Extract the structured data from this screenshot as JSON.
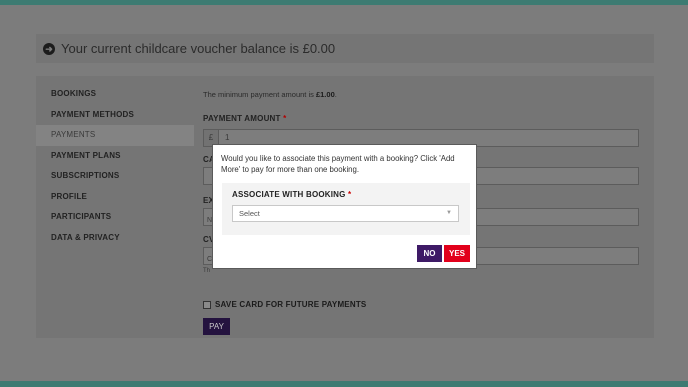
{
  "voucher": {
    "icon": "arrow-right-circle-icon",
    "text": "Your current childcare voucher balance is £0.00"
  },
  "sidebar": {
    "items": [
      {
        "label": "BOOKINGS"
      },
      {
        "label": "PAYMENT METHODS"
      },
      {
        "label": "PAYMENTS",
        "active": true
      },
      {
        "label": "PAYMENT PLANS"
      },
      {
        "label": "SUBSCRIPTIONS"
      },
      {
        "label": "PROFILE"
      },
      {
        "label": "PARTICIPANTS"
      },
      {
        "label": "DATA & PRIVACY"
      }
    ]
  },
  "form": {
    "min_note_prefix": "The minimum payment amount is ",
    "min_note_amount": "£1.00",
    "min_note_suffix": ".",
    "amount_label": "PAYMENT AMOUNT",
    "required_mark": "*",
    "currency": "£",
    "amount_value": "1",
    "card_label_partial": "CA",
    "expiry_label_partial": "EX",
    "expiry_value_partial": "N",
    "cvv_label_partial": "CV",
    "cvv_value_partial": "C",
    "cvv_hint_partial": "Th",
    "save_card_label": "SAVE CARD FOR FUTURE PAYMENTS",
    "pay_button": "PAY"
  },
  "modal": {
    "message": "Would you like to associate this payment with a booking? Click 'Add More' to pay for more than one booking.",
    "associate_label": "ASSOCIATE WITH BOOKING",
    "required_mark": "*",
    "select_placeholder": "Select",
    "no_button": "NO",
    "yes_button": "YES"
  },
  "colors": {
    "accent_teal": "#3d7b72",
    "no_button": "#3e1a66",
    "yes_button": "#e2001b"
  }
}
